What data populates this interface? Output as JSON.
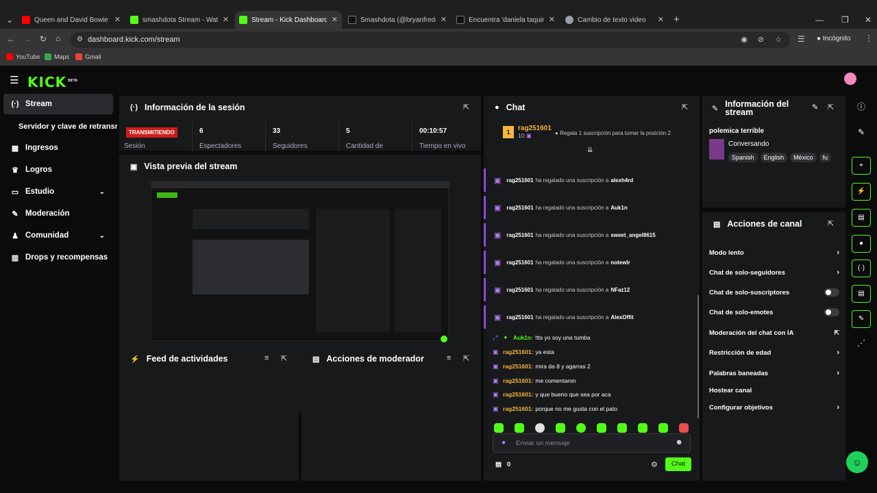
{
  "browser": {
    "tabs": [
      {
        "title": "Queen and David Bowie - U",
        "color": "#ff0000"
      },
      {
        "title": "smashdota Stream - Watch Live",
        "color": "#53fc18"
      },
      {
        "title": "Stream - Kick Dashboard",
        "color": "#53fc18"
      },
      {
        "title": "Smashdota (@bryanfreddy) es",
        "color": "#111111"
      },
      {
        "title": "Encuentra 'daniela taquire' en T",
        "color": "#111111"
      },
      {
        "title": "Cambio de texto video",
        "color": "#9aa0a6"
      }
    ],
    "url": "dashboard.kick.com/stream",
    "incognito_label": "Incógnito",
    "bookmarks": [
      "YouTube",
      "Maps",
      "Gmail"
    ]
  },
  "app": {
    "logo": "KICK",
    "logo_badge": "BETA",
    "sidebar": [
      {
        "label": "Stream",
        "icon": "(·)"
      },
      {
        "label": "Servidor y clave de retransmisión",
        "icon": ""
      },
      {
        "label": "Ingresos",
        "icon": "▦"
      },
      {
        "label": "Logros",
        "icon": "🏆"
      },
      {
        "label": "Estudio",
        "icon": "▭"
      },
      {
        "label": "Moderación",
        "icon": "✎"
      },
      {
        "label": "Comunidad",
        "icon": "👥"
      },
      {
        "label": "Drops y recompensas",
        "icon": "▥"
      }
    ],
    "session": {
      "title": "Información de la sesión",
      "status_badge": "TRANSMITIENDO",
      "status_label": "Sesión",
      "stats": [
        {
          "value": "6",
          "label": "Espectadores"
        },
        {
          "value": "33",
          "label": "Seguidores"
        },
        {
          "value": "5",
          "label": "Cantidad de"
        },
        {
          "value": "00:10:57",
          "label": "Tiempo en vivo"
        }
      ]
    },
    "preview": {
      "title": "Vista previa del stream"
    },
    "activity": {
      "title": "Feed de actividades"
    },
    "moderator": {
      "title": "Acciones de moderador"
    },
    "chat": {
      "title": "Chat",
      "pinned_user": "rag251601",
      "pinned_count": "10",
      "pinned_rank": "1",
      "gift_prompt": "Regala 1 suscripción para tomar la posición 2",
      "event_text": "ha regalado una suscripción a",
      "events": [
        {
          "user": "rag251601",
          "target": "alexh4rd"
        },
        {
          "user": "rag251601",
          "target": "Auk1n"
        },
        {
          "user": "rag251601",
          "target": "sweet_angel8615"
        },
        {
          "user": "rag251601",
          "target": "notewlr"
        },
        {
          "user": "rag251601",
          "target": "NFaz12"
        },
        {
          "user": "rag251601",
          "target": "AlexOffit"
        }
      ],
      "messages": [
        {
          "user": "Auk1n:",
          "text": "!tts yo soy una tumba",
          "color": "#53fc18"
        },
        {
          "user": "rag251601:",
          "text": "ya esta",
          "color": "#f5b73b"
        },
        {
          "user": "rag251601:",
          "text": "mira da 8 y agarras 2",
          "color": "#f5b73b"
        },
        {
          "user": "rag251601:",
          "text": "me comentaron",
          "color": "#f5b73b"
        },
        {
          "user": "rag251601:",
          "text": "y que bueno que sea por aca",
          "color": "#f5b73b"
        },
        {
          "user": "rag251601:",
          "text": "porque no me gusta con el pato",
          "color": "#f5b73b"
        }
      ],
      "input_placeholder": "Enviar un mensaje",
      "points": "0",
      "send_label": "Chat"
    },
    "stream_info": {
      "title_line1": "Información del",
      "title_line2": "stream",
      "stream_title": "polemica terrible",
      "category": "Conversando",
      "tags": [
        "Spanish",
        "English",
        "México",
        "fu"
      ]
    },
    "channel_actions": {
      "title": "Acciones de canal",
      "items": [
        {
          "label": "Modo lento",
          "control": "arrow"
        },
        {
          "label": "Chat de solo-seguidores",
          "control": "arrow"
        },
        {
          "label": "Chat de solo-suscriptores",
          "control": "toggle"
        },
        {
          "label": "Chat de solo-emotes",
          "control": "toggle"
        },
        {
          "label": "Moderación del chat con IA",
          "control": "external"
        },
        {
          "label": "Restricción de edad",
          "control": "arrow"
        },
        {
          "label": "Palabras baneadas",
          "control": "arrow"
        },
        {
          "label": "Hostear canal",
          "control": "none"
        },
        {
          "label": "Configurar objetivos",
          "control": "arrow"
        }
      ]
    },
    "accent_color": "#53fc18"
  }
}
